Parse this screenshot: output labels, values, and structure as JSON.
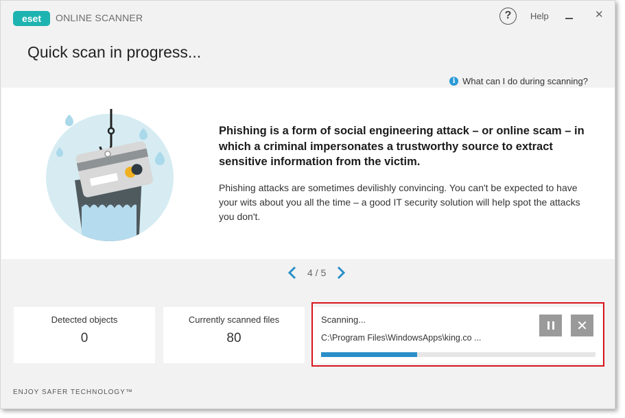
{
  "app": {
    "brand": "eset",
    "product_name": "ONLINE SCANNER",
    "help_label": "Help",
    "help_glyph": "?",
    "close_glyph": "✕"
  },
  "page": {
    "title": "Quick scan in progress...",
    "info_link": "What can I do during scanning?",
    "info_glyph": "i"
  },
  "content": {
    "headline": "Phishing is a form of social engineering attack – or online scam – in which a criminal impersonates a trustworthy source to extract sensitive information from the victim.",
    "body": "Phishing attacks are sometimes devilishly convincing. You can't be expected to have your wits about you all the time – a good IT security solution will help spot the attacks you don't.",
    "illustration_icon": "phishing-hook-credit-card-icon"
  },
  "pager": {
    "text": "4 / 5",
    "current": 4,
    "total": 5
  },
  "stats": {
    "detected": {
      "label": "Detected objects",
      "value": "0"
    },
    "scanned": {
      "label": "Currently scanned files",
      "value": "80"
    }
  },
  "scan": {
    "status": "Scanning...",
    "path": "C:\\Program Files\\WindowsApps\\king.co ...",
    "progress_fraction": 0.35,
    "stop_glyph": "✕"
  },
  "footer": {
    "tagline": "ENJOY SAFER TECHNOLOGY™"
  },
  "colors": {
    "brand_teal": "#1db3b0",
    "accent_blue": "#2a8fc8",
    "highlight_red": "#d9141b",
    "button_gray": "#9a9a9a"
  }
}
